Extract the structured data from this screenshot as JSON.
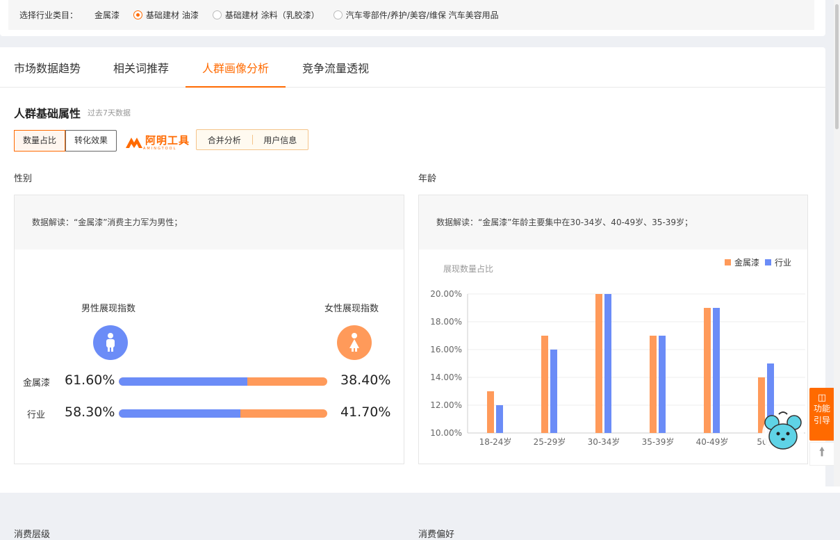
{
  "filter": {
    "label": "选择行业类目：",
    "category": "金属漆",
    "options": [
      {
        "label": "基础建材 油漆",
        "selected": true
      },
      {
        "label": "基础建材 涂料（乳胶漆）",
        "selected": false
      },
      {
        "label": "汽车零部件/养护/美容/维保 汽车美容用品",
        "selected": false
      }
    ]
  },
  "tabs": [
    {
      "label": "市场数据趋势",
      "active": false
    },
    {
      "label": "相关词推荐",
      "active": false
    },
    {
      "label": "人群画像分析",
      "active": true
    },
    {
      "label": "竞争流量透视",
      "active": false
    }
  ],
  "section": {
    "title": "人群基础属性",
    "subtitle": "过去7天数据"
  },
  "segments": [
    "数量占比",
    "转化效果"
  ],
  "logo": {
    "text": "阿明工具",
    "sub": "AMINGTOOL"
  },
  "actions": [
    "合并分析",
    "用户信息"
  ],
  "gender": {
    "label": "性别",
    "note": "数据解读：“金属漆”消费主力军为男性；",
    "male_title": "男性展现指数",
    "female_title": "女性展现指数",
    "rows": [
      {
        "label": "金属漆",
        "male": "61.60%",
        "female": "38.40%",
        "male_fraction": 0.616
      },
      {
        "label": "行业",
        "male": "58.30%",
        "female": "41.70%",
        "male_fraction": 0.583
      }
    ],
    "male_color": "#6b8cf7",
    "female_color": "#ff9a5a"
  },
  "age": {
    "label": "年龄",
    "note": "数据解读：“金属漆”年龄主要集中在30-34岁、40-49岁、35-39岁；"
  },
  "chart_data": {
    "type": "bar",
    "ylabel": "展现数量占比",
    "categories": [
      "18-24岁",
      "25-29岁",
      "30-34岁",
      "35-39岁",
      "40-49岁",
      "50岁"
    ],
    "series": [
      {
        "name": "金属漆",
        "color": "#ff9a5a",
        "values": [
          13,
          17,
          20,
          17,
          19,
          14
        ]
      },
      {
        "name": "行业",
        "color": "#6b8cf7",
        "values": [
          12,
          16,
          20,
          17,
          19,
          15
        ]
      }
    ],
    "ylim": [
      10,
      20
    ],
    "yticks": [
      "10.00%",
      "12.00%",
      "14.00%",
      "16.00%",
      "18.00%",
      "20.00%"
    ],
    "legend": "top-right",
    "grid": true
  },
  "side": {
    "guide": [
      "功能",
      "引导"
    ]
  },
  "peek": [
    "消费层级",
    "消费偏好"
  ]
}
